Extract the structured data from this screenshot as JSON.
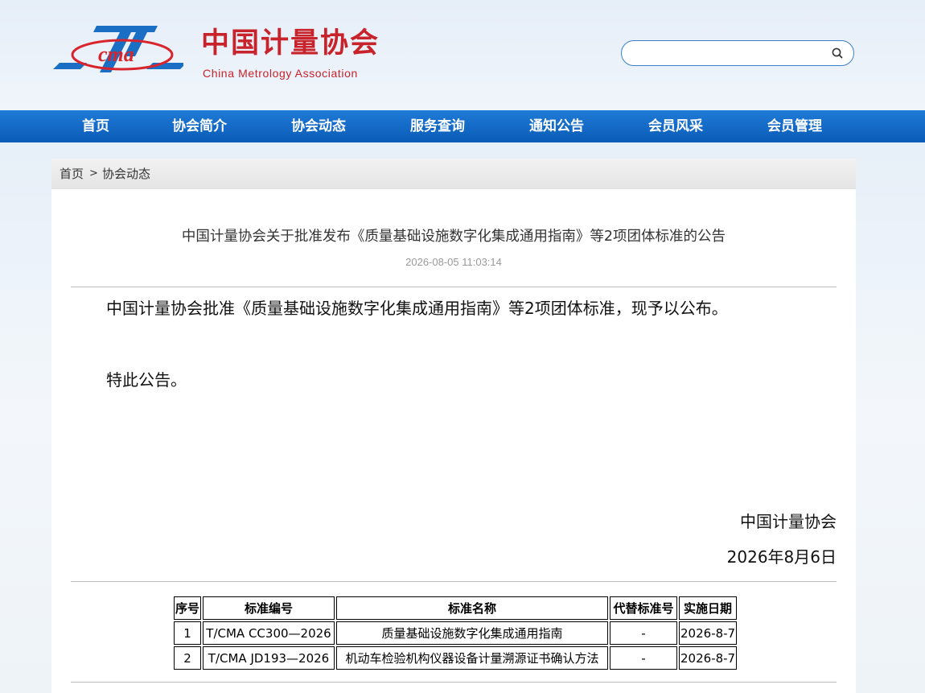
{
  "header": {
    "logo_text": "cma",
    "brand_cn": "中国计量协会",
    "brand_en": "China Metrology Association",
    "search_value": "",
    "search_icon": "search-icon"
  },
  "nav": {
    "items": [
      {
        "label": "首页"
      },
      {
        "label": "协会简介"
      },
      {
        "label": "协会动态"
      },
      {
        "label": "服务查询"
      },
      {
        "label": "通知公告"
      },
      {
        "label": "会员风采"
      },
      {
        "label": "会员管理"
      }
    ]
  },
  "breadcrumb": {
    "home": "首页",
    "separator": ">",
    "current": "协会动态"
  },
  "article": {
    "title": "中国计量协会关于批准发布《质量基础设施数字化集成通用指南》等2项团体标准的公告",
    "time": "2026-08-05 11:03:14",
    "body": [
      "中国计量协会批准《质量基础设施数字化集成通用指南》等2项团体标准，现予以公布。",
      "特此公告。"
    ],
    "signature_org": "中国计量协会",
    "signature_date": "2026年8月6日"
  },
  "table": {
    "headers": [
      "序号",
      "标准编号",
      "标准名称",
      "代替标准号",
      "实施日期"
    ],
    "rows": [
      [
        "1",
        "T/CMA CC300—2026",
        "质量基础设施数字化集成通用指南",
        "-",
        "2026-8-7"
      ],
      [
        "2",
        "T/CMA JD193—2026",
        "机动车检验机构仪器设备计量溯源证书确认方法",
        "-",
        "2026-8-7"
      ]
    ]
  },
  "colors": {
    "brand_red": "#c8222a",
    "nav_blue": "#0a5cb8",
    "logo_blue": "#1a6fc4"
  }
}
